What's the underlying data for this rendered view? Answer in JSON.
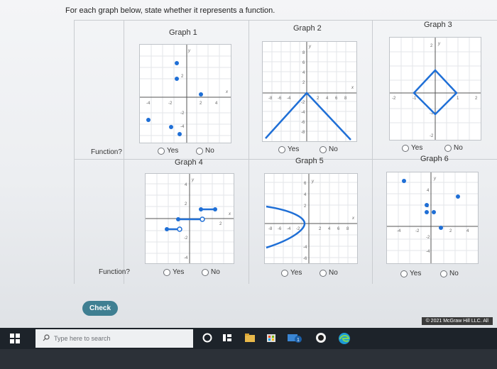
{
  "instruction": "For each graph below, state whether it represents a function.",
  "function_label": "Function?",
  "options": {
    "yes": "Yes",
    "no": "No"
  },
  "graphs": [
    {
      "title": "Graph 1",
      "ticks": [
        "-4",
        "-2",
        "2",
        "4",
        "2",
        "-2",
        "-4"
      ]
    },
    {
      "title": "Graph 2",
      "ticks": [
        "-8",
        "-6",
        "-4",
        "2",
        "4",
        "6",
        "8",
        "8",
        "6",
        "4",
        "2",
        "-2",
        "-4",
        "-6",
        "-8"
      ]
    },
    {
      "title": "Graph 3",
      "ticks": [
        "-2",
        "-1",
        "1",
        "2",
        "2",
        "-1",
        "-2"
      ]
    },
    {
      "title": "Graph 4",
      "ticks": [
        "4",
        "2",
        "2",
        "-2",
        "-4"
      ]
    },
    {
      "title": "Graph 5",
      "ticks": [
        "-8",
        "-6",
        "-4",
        "-2",
        "2",
        "4",
        "6",
        "8",
        "6",
        "4",
        "2",
        "-4",
        "-6"
      ]
    },
    {
      "title": "Graph 6",
      "ticks": [
        "-4",
        "-2",
        "2",
        "4",
        "4",
        "2",
        "-2",
        "-4"
      ]
    }
  ],
  "axis_labels": {
    "x": "x",
    "y": "y"
  },
  "check_label": "Check",
  "copyright": "© 2021 McGraw Hill LLC. All",
  "taskbar": {
    "search_placeholder": "Type here to search"
  },
  "colors": {
    "accent": "#3f7f92",
    "plot": "#1f6fd6",
    "taskbar": "#1d232a"
  }
}
